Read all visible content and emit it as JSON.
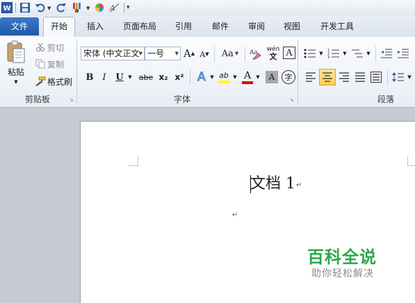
{
  "tabs": {
    "file": "文件",
    "home": "开始",
    "insert": "插入",
    "page_layout": "页面布局",
    "references": "引用",
    "mailings": "邮件",
    "review": "审阅",
    "view": "视图",
    "developer": "开发工具"
  },
  "clipboard": {
    "paste": "粘贴",
    "cut": "剪切",
    "copy": "复制",
    "format_painter": "格式刷",
    "group_label": "剪贴板"
  },
  "font": {
    "font_name": "宋体 (中文正文",
    "font_size": "一号",
    "change_case": "Aa",
    "bold": "B",
    "italic": "I",
    "underline": "U",
    "strikethrough": "abe",
    "subscript": "x₂",
    "superscript": "x²",
    "group_label": "字体",
    "grow_font": "A",
    "shrink_font": "A",
    "pinyin_guide": "wén",
    "char_border": "A",
    "char_shading": "A",
    "enclose_char": "字",
    "text_effect": "A",
    "highlight": "ab",
    "font_color": "A",
    "colors": {
      "font_color_bar": "#e00000",
      "highlight_bar": "#ffff00"
    }
  },
  "paragraph": {
    "group_label": "段落"
  },
  "document": {
    "title_text": "文档 1"
  },
  "watermark": {
    "title": "百科全说",
    "subtitle": "助你轻松解决"
  },
  "colors": {
    "file_tab": "#2a66b5",
    "watermark_green": "#2ba84a",
    "page_bg": "#ffffff",
    "workspace_bg": "#c6cbd3"
  }
}
